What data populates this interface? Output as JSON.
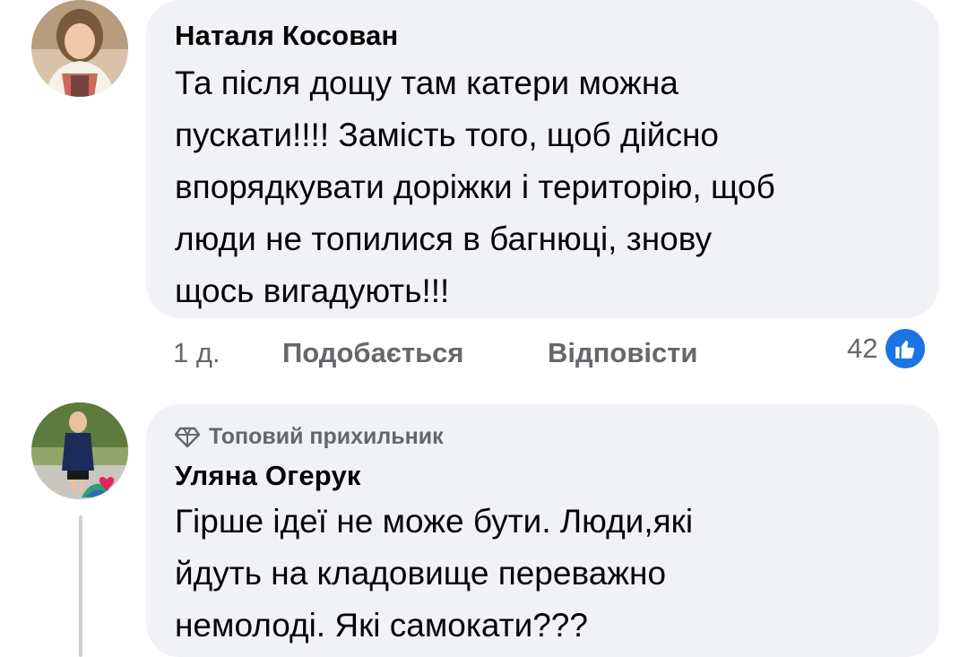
{
  "comments": [
    {
      "author": "Наталя Косован",
      "text": "Та після дощу там катери можна\nпускати!!!! Замість того, щоб дійсно\nвпорядкувати доріжки і територію, щоб\nлюди не топилися в багнюці, знову\nщось вигадують!!!",
      "time": "1 д.",
      "like_label": "Подобається",
      "reply_label": "Відповісти",
      "reaction_count": "42",
      "reaction_icon": "like-icon"
    },
    {
      "badge": "Топовий прихильник",
      "badge_icon": "diamond-icon",
      "author": "Уляна Огерук",
      "text": "Гірше ідеї не може бути. Люди,які\nйдуть на кладовище переважно\nнемолоді. Які самокати???"
    }
  ],
  "colors": {
    "bubble": "#f0f2f5",
    "text": "#050505",
    "secondary": "#65676b",
    "like_blue": "#1b74e4"
  }
}
